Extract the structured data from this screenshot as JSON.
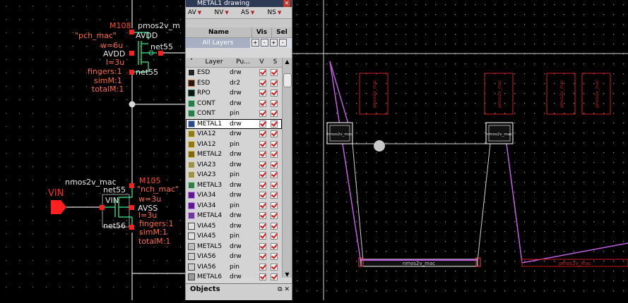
{
  "schematic": {
    "pmos": {
      "symbol": "pmos2v_m",
      "inst": "M108",
      "model": "\"pch_mac\"",
      "w": "w=6u",
      "l": "l=3u",
      "fingers": "fingers:1",
      "simM": "simM:1",
      "totalM": "totalM:1",
      "pin_bulk": "AVDD",
      "pin_source": "AVDD",
      "net_drain_top": "net55",
      "net_drain_bot": "net55"
    },
    "nmos": {
      "symbol": "nmos2v_mac",
      "inst": "M105",
      "model": "\"nch_mac\"",
      "w": "w=3u",
      "l": "l=3u",
      "fingers": "fingers:1",
      "simM": "simM:1",
      "totalM": "totalM:1",
      "pin_gate": "VIN",
      "pin_bulk": "AVSS",
      "net_top": "net55",
      "net_bot": "net56"
    },
    "input_pin": "VIN"
  },
  "lpp": {
    "title": "METAL1 drawing",
    "filters": [
      "AV",
      "NV",
      "AS",
      "NS"
    ],
    "table_headers": {
      "name": "Name",
      "vis": "Vis",
      "sel": "Sel"
    },
    "all_layers": "All Layers",
    "mini_buttons": [
      "+",
      "-",
      "+",
      "-"
    ],
    "list_headers": {
      "layer": "Layer",
      "purpose": "Pu...",
      "v": "V",
      "s": "S"
    },
    "layers": [
      {
        "name": "ESD",
        "purpose": "drw",
        "color": "#222222",
        "border": "#e0e0e0"
      },
      {
        "name": "ESD",
        "purpose": "dr2",
        "color": "#1a1a1a",
        "border": "#e07030"
      },
      {
        "name": "RPO",
        "purpose": "drw",
        "color": "#111111",
        "border": "#2a8a6a"
      },
      {
        "name": "CONT",
        "purpose": "drw",
        "color": "#2a7a4a",
        "border": "#8fd0a0"
      },
      {
        "name": "CONT",
        "purpose": "pin",
        "color": "#2a7a4a",
        "border": "#8fd0a0"
      },
      {
        "name": "METAL1",
        "purpose": "drw",
        "color": "#2a4a8a",
        "border": "#aab8e0"
      },
      {
        "name": "VIA12",
        "purpose": "drw",
        "color": "#8a7a20",
        "border": "#e8d060"
      },
      {
        "name": "VIA12",
        "purpose": "pin",
        "color": "#8a7a20",
        "border": "#e8d060"
      },
      {
        "name": "METAL2",
        "purpose": "drw",
        "color": "#7a6a1a",
        "border": "#e0c050"
      },
      {
        "name": "VIA23",
        "purpose": "drw",
        "color": "#9a9050",
        "border": "#e0d8a0"
      },
      {
        "name": "VIA23",
        "purpose": "pin",
        "color": "#9a9050",
        "border": "#e0d8a0"
      },
      {
        "name": "METAL3",
        "purpose": "drw",
        "color": "#3a7a4a",
        "border": "#a0e0b0"
      },
      {
        "name": "VIA34",
        "purpose": "drw",
        "color": "#5a1a8a",
        "border": "#c080f0"
      },
      {
        "name": "VIA34",
        "purpose": "pin",
        "color": "#5a1a8a",
        "border": "#c080f0"
      },
      {
        "name": "METAL4",
        "purpose": "drw",
        "color": "#6a3a9a",
        "border": "#d0a0f0"
      },
      {
        "name": "VIA45",
        "purpose": "drw",
        "color": "#e0e0e0",
        "border": "#404040"
      },
      {
        "name": "VIA45",
        "purpose": "pin",
        "color": "#e0e0e0",
        "border": "#404040"
      },
      {
        "name": "METAL5",
        "purpose": "drw",
        "color": "#bbbbbb",
        "border": "#505050"
      },
      {
        "name": "VIA56",
        "purpose": "drw",
        "color": "#cccccc",
        "border": "#404040"
      },
      {
        "name": "VIA56",
        "purpose": "pin",
        "color": "#cccccc",
        "border": "#404040"
      },
      {
        "name": "METAL6",
        "purpose": "drw",
        "color": "#999999",
        "border": "#404040"
      }
    ],
    "selected_index": 5
  },
  "objects": {
    "title": "Objects"
  },
  "layout": {
    "instances": [
      {
        "label": "nmos2v_mac"
      },
      {
        "label": "nmos2v_mac"
      },
      {
        "label": "nmos2v_mac"
      }
    ],
    "pmos_labels": [
      "pmos2v_mac",
      "pmos2v_mac",
      "pmos2v_mac",
      "pmos2v_mac"
    ],
    "colors": {
      "metal": "#c060e0",
      "boundary": "#d02020",
      "inst": "#ffffff",
      "pin": "#ff4060"
    }
  }
}
